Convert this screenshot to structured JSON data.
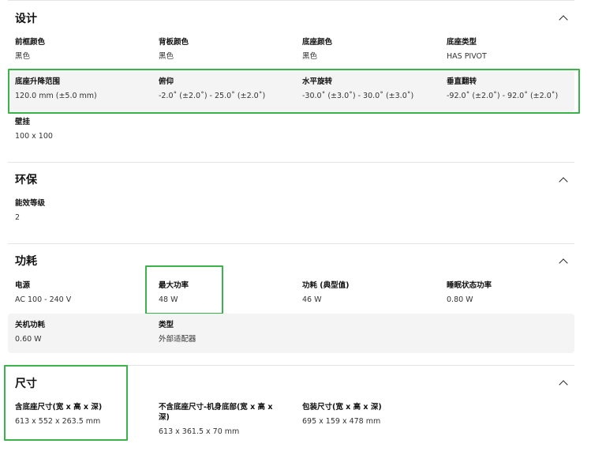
{
  "sections": {
    "design": {
      "title": "设计",
      "items": [
        {
          "label": "前框颜色",
          "value": "黑色"
        },
        {
          "label": "背板颜色",
          "value": "黑色"
        },
        {
          "label": "底座颜色",
          "value": "黑色"
        },
        {
          "label": "底座类型",
          "value": "HAS PIVOT"
        },
        {
          "label": "底座升降范围",
          "value": "120.0 mm (±5.0 mm)"
        },
        {
          "label": "俯仰",
          "value": "-2.0˚ (±2.0˚) - 25.0˚ (±2.0˚)"
        },
        {
          "label": "水平旋转",
          "value": "-30.0˚ (±3.0˚) - 30.0˚ (±3.0˚)"
        },
        {
          "label": "垂直翻转",
          "value": "-92.0˚ (±2.0˚) - 92.0˚ (±2.0˚)"
        },
        {
          "label": "壁挂",
          "value": "100 x 100"
        }
      ]
    },
    "eco": {
      "title": "环保",
      "items": [
        {
          "label": "能效等级",
          "value": "2"
        }
      ]
    },
    "power": {
      "title": "功耗",
      "items": [
        {
          "label": "电源",
          "value": "AC 100 - 240 V"
        },
        {
          "label": "最大功率",
          "value": "48 W"
        },
        {
          "label": "功耗 (典型值)",
          "value": "46 W"
        },
        {
          "label": "睡眠状态功率",
          "value": "0.80 W"
        },
        {
          "label": "关机功耗",
          "value": "0.60 W"
        },
        {
          "label": "类型",
          "value": "外部适配器"
        }
      ]
    },
    "dimensions": {
      "title": "尺寸",
      "items": [
        {
          "label": "含底座尺寸(宽 x 高 x 深)",
          "value": "613 x 552 x 263.5 mm"
        },
        {
          "label": "不含底座尺寸-机身底部(宽 x 高 x 深)",
          "value": "613 x 361.5 x 70 mm"
        },
        {
          "label": "包装尺寸(宽 x 高 x 深)",
          "value": "695 x 159 x 478 mm"
        }
      ]
    }
  },
  "colors": {
    "highlight": "#3bb34a",
    "row_shade": "#f4f4f4",
    "divider": "#e4e4e4"
  },
  "icons": {
    "section_toggle": "chevron-up-icon"
  }
}
